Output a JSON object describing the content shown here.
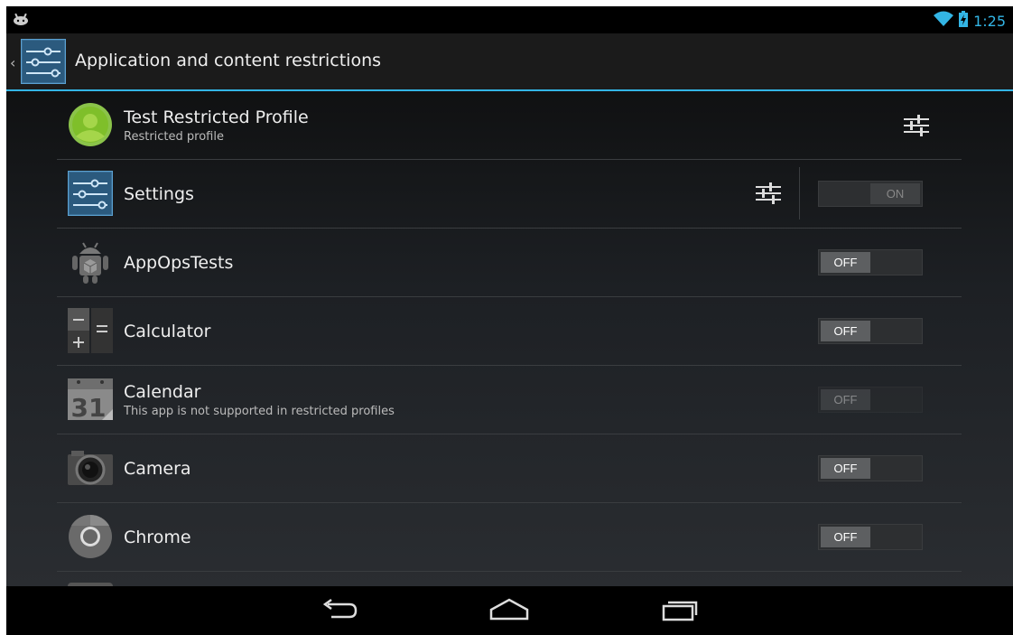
{
  "statusbar": {
    "time": "1:25"
  },
  "actionbar": {
    "title": "Application and content restrictions"
  },
  "profile": {
    "title": "Test Restricted Profile",
    "subtitle": "Restricted profile"
  },
  "apps": [
    {
      "name": "Settings",
      "subtitle": "",
      "toggle": "ON",
      "state": "on"
    },
    {
      "name": "AppOpsTests",
      "subtitle": "",
      "toggle": "OFF",
      "state": "off"
    },
    {
      "name": "Calculator",
      "subtitle": "",
      "toggle": "OFF",
      "state": "off"
    },
    {
      "name": "Calendar",
      "subtitle": "This app is not supported in restricted profiles",
      "toggle": "OFF",
      "state": "disabled"
    },
    {
      "name": "Camera",
      "subtitle": "",
      "toggle": "OFF",
      "state": "off"
    },
    {
      "name": "Chrome",
      "subtitle": "",
      "toggle": "OFF",
      "state": "off"
    }
  ],
  "calendar_icon_day": "31",
  "icons": {
    "status_left": "android-notification-icon",
    "wifi": "wifi-icon",
    "battery": "battery-charging-icon",
    "back": "back-icon",
    "home": "home-icon",
    "recents": "recent-apps-icon"
  },
  "colors": {
    "accent": "#33b5e5",
    "background": "#000000"
  }
}
